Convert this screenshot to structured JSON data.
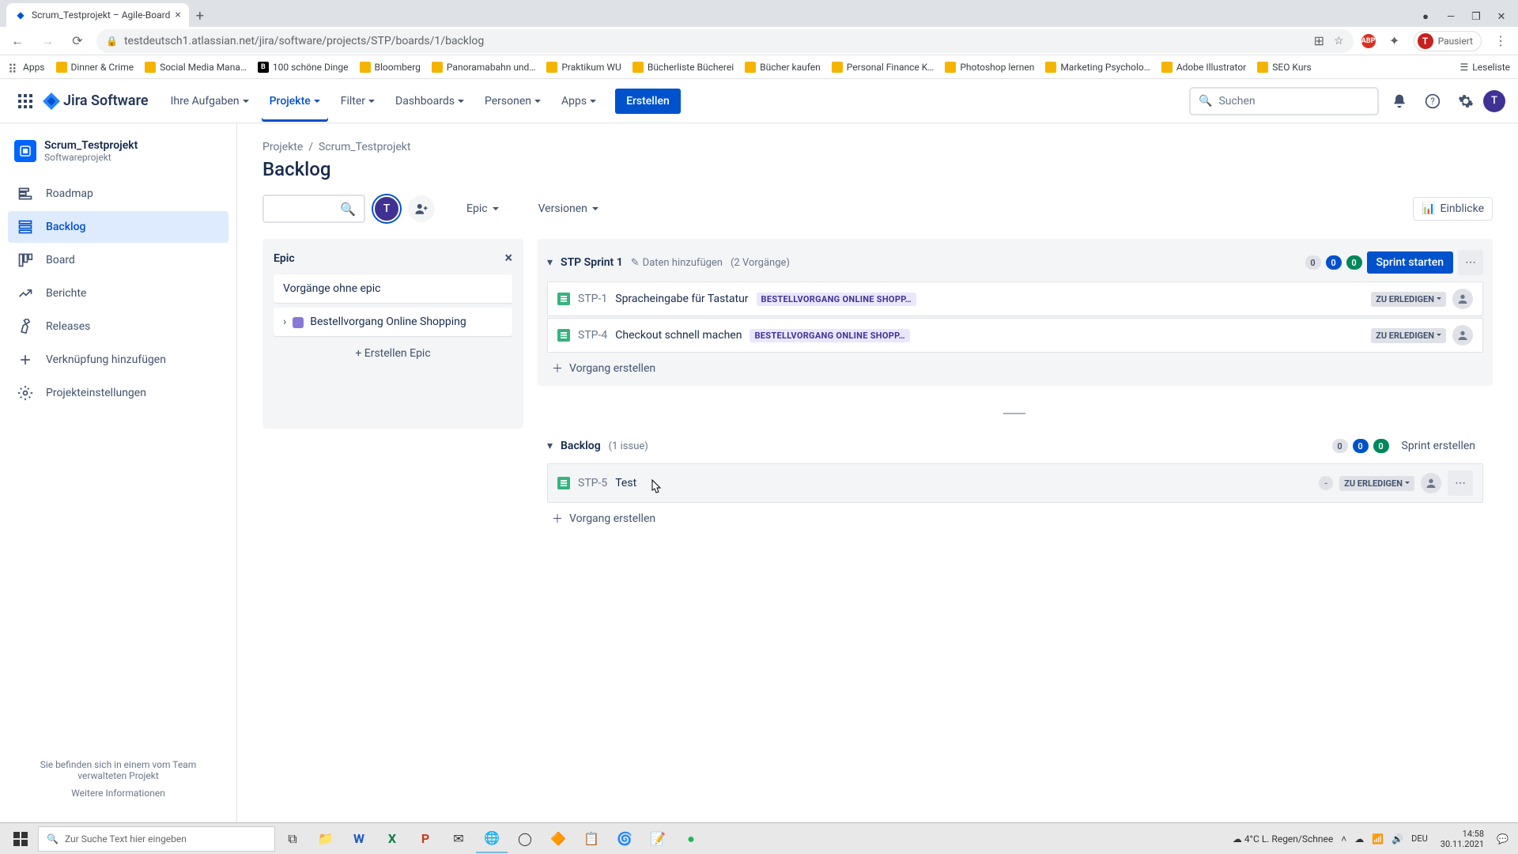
{
  "browser": {
    "tab_title": "Scrum_Testprojekt – Agile-Board",
    "url": "testdeutsch1.atlassian.net/jira/software/projects/STP/boards/1/backlog",
    "profile_status": "Pausiert",
    "profile_initial": "T",
    "bookmarks": [
      "Apps",
      "Dinner & Crime",
      "Social Media Mana…",
      "100 schöne Dinge",
      "Bloomberg",
      "Panoramabahn und…",
      "Praktikum WU",
      "Bücherliste Bücherei",
      "Bücher kaufen",
      "Personal Finance K…",
      "Photoshop lernen",
      "Marketing Psycholo…",
      "Adobe Illustrator",
      "SEO Kurs"
    ],
    "bookmarks_overflow": "Leseliste"
  },
  "nav": {
    "product": "Jira Software",
    "items": [
      "Ihre Aufgaben",
      "Projekte",
      "Filter",
      "Dashboards",
      "Personen",
      "Apps"
    ],
    "active_index": 1,
    "create": "Erstellen",
    "search_placeholder": "Suchen"
  },
  "sidebar": {
    "project_name": "Scrum_Testprojekt",
    "project_type": "Softwareprojekt",
    "items": [
      "Roadmap",
      "Backlog",
      "Board",
      "Berichte",
      "Releases",
      "Verknüpfung hinzufügen",
      "Projekteinstellungen"
    ],
    "active_index": 1,
    "footer_note": "Sie befinden sich in einem vom Team verwalteten Projekt",
    "footer_link": "Weitere Informationen"
  },
  "breadcrumb": {
    "root": "Projekte",
    "project": "Scrum_Testprojekt"
  },
  "page": {
    "title": "Backlog",
    "filters": {
      "epic": "Epic",
      "versions": "Versionen"
    },
    "insights": "Einblicke"
  },
  "epic_panel": {
    "title": "Epic",
    "no_epic": "Vorgänge ohne epic",
    "epics": [
      {
        "name": "Bestellvorgang Online Shopping"
      }
    ],
    "create": "Erstellen Epic"
  },
  "sprint": {
    "name": "STP Sprint 1",
    "add_dates": "Daten hinzufügen",
    "count_text": "(2 Vorgänge)",
    "pills": [
      "0",
      "0",
      "0"
    ],
    "start_label": "Sprint starten",
    "issues": [
      {
        "key": "STP-1",
        "summary": "Spracheingabe für Tastatur",
        "epic": "BESTELLVORGANG ONLINE SHOPP…",
        "status": "ZU ERLEDIGEN"
      },
      {
        "key": "STP-4",
        "summary": "Checkout schnell machen",
        "epic": "BESTELLVORGANG ONLINE SHOPP…",
        "status": "ZU ERLEDIGEN"
      }
    ],
    "create_issue": "Vorgang erstellen"
  },
  "backlog": {
    "name": "Backlog",
    "count_text": "(1 issue)",
    "pills": [
      "0",
      "0",
      "0"
    ],
    "create_sprint": "Sprint erstellen",
    "issues": [
      {
        "key": "STP-5",
        "summary": "Test",
        "status": "ZU ERLEDIGEN"
      }
    ],
    "create_issue": "Vorgang erstellen"
  },
  "taskbar": {
    "search_placeholder": "Zur Suche Text hier eingeben",
    "weather": "4°C  L. Regen/Schnee",
    "time": "14:58",
    "date": "30.11.2021"
  }
}
